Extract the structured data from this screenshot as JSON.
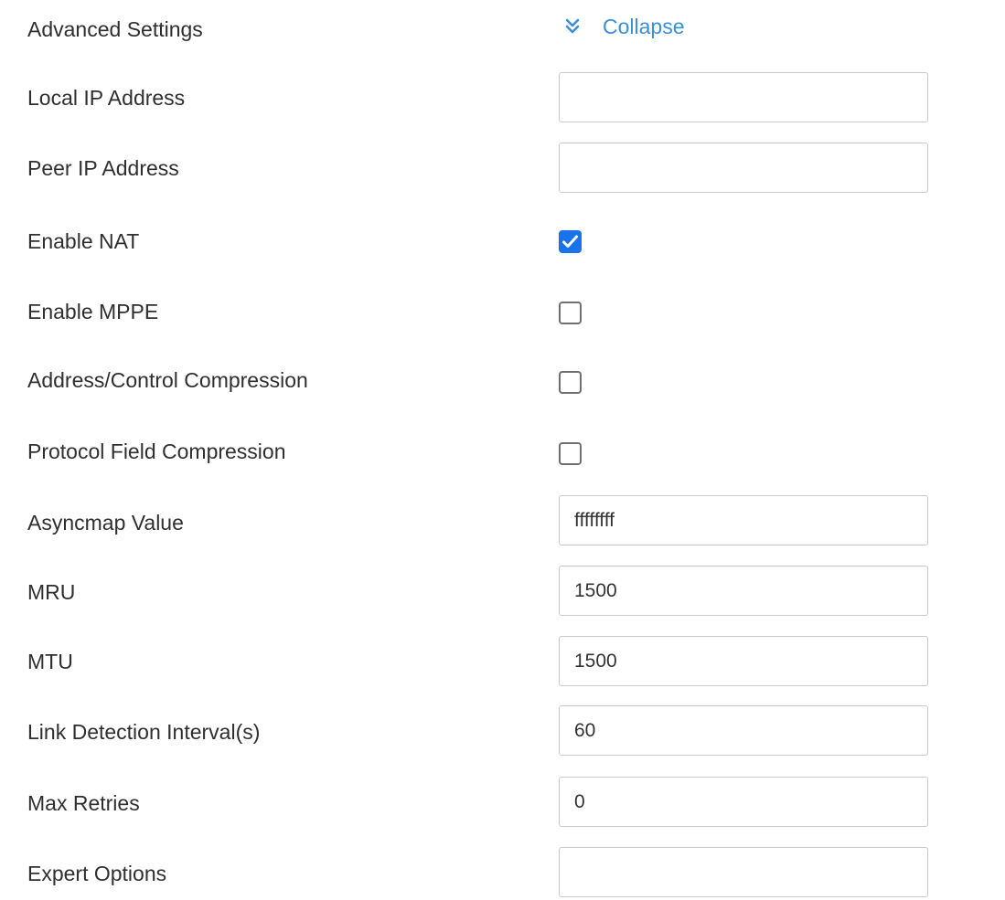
{
  "section": {
    "title": "Advanced Settings",
    "toggle_label": "Collapse",
    "toggle_icon": "double-chevron-down-icon",
    "accent_color": "#3b8fd8"
  },
  "fields": {
    "local_ip": {
      "label": "Local IP Address",
      "value": ""
    },
    "peer_ip": {
      "label": "Peer IP Address",
      "value": ""
    },
    "enable_nat": {
      "label": "Enable NAT",
      "checked": true
    },
    "enable_mppe": {
      "label": "Enable MPPE",
      "checked": false
    },
    "address_control_compression": {
      "label": "Address/Control Compression",
      "checked": false
    },
    "protocol_field_compression": {
      "label": "Protocol Field Compression",
      "checked": false
    },
    "asyncmap_value": {
      "label": "Asyncmap Value",
      "value": "ffffffff"
    },
    "mru": {
      "label": "MRU",
      "value": "1500"
    },
    "mtu": {
      "label": "MTU",
      "value": "1500"
    },
    "link_detection_interval": {
      "label": "Link Detection Interval(s)",
      "value": "60"
    },
    "max_retries": {
      "label": "Max Retries",
      "value": "0"
    },
    "expert_options": {
      "label": "Expert Options",
      "value": ""
    }
  },
  "colors": {
    "checkbox_checked": "#1a73e8",
    "input_border": "#c9c9c9"
  }
}
